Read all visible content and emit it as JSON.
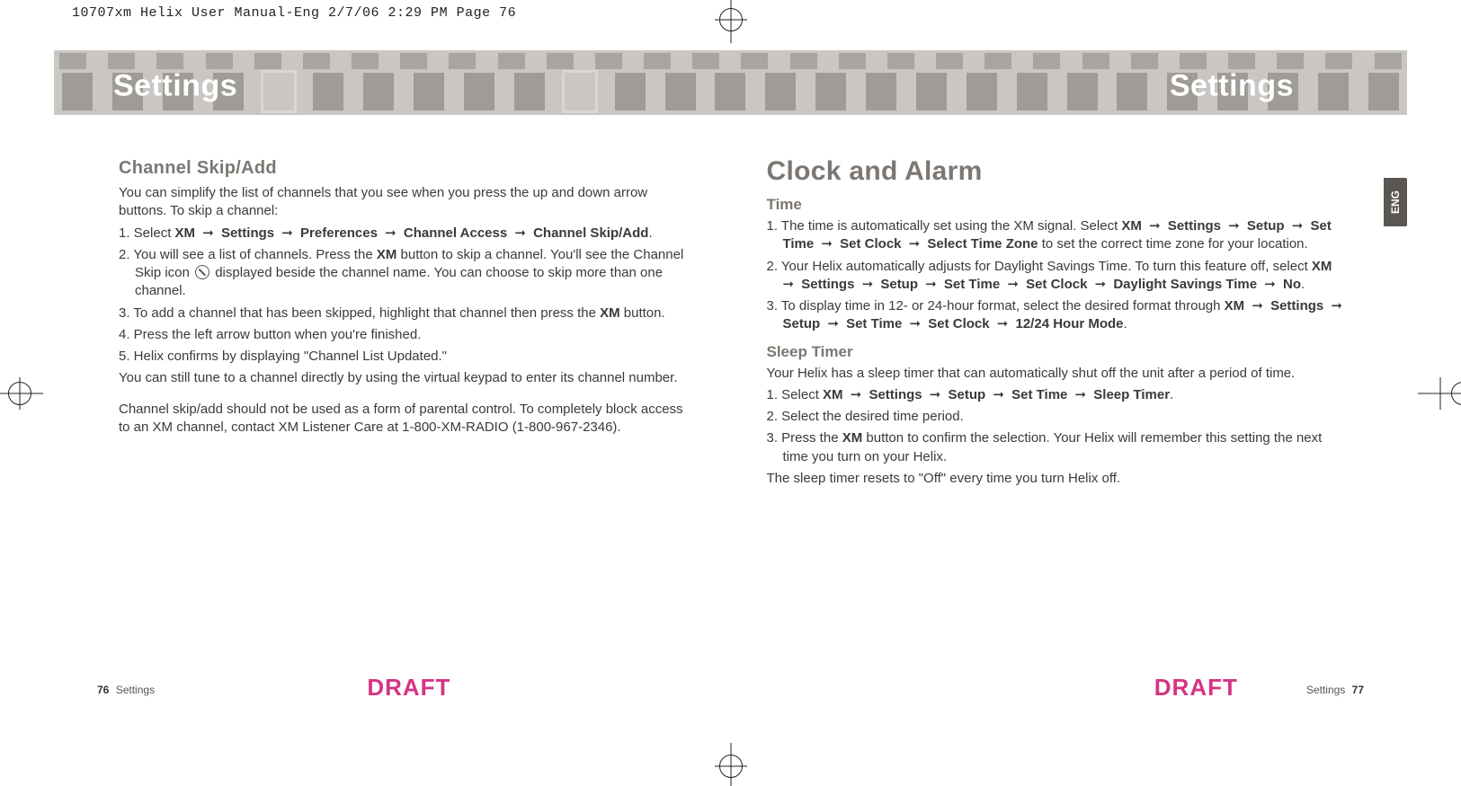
{
  "slug": "10707xm Helix User Manual-Eng  2/7/06  2:29 PM  Page 76",
  "banner": {
    "title_left": "Settings",
    "title_right": "Settings"
  },
  "lang_tab": "ENG",
  "arrow": "➞",
  "left": {
    "h2": "Channel Skip/Add",
    "intro": "You can simplify the list of channels that you see when you press the up and down arrow buttons. To skip a channel:",
    "steps": [
      {
        "pre": "1. Select ",
        "path": [
          "XM",
          "Settings",
          "Preferences",
          "Channel Access",
          "Channel Skip/Add"
        ],
        "post": "."
      },
      {
        "pre": "2. You will see a list of channels. Press the ",
        "bold1": "XM",
        "mid": " button to skip a channel. You'll see the Channel Skip icon ",
        "icon": true,
        "post": " displayed beside the channel name. You can choose to skip more than one channel."
      },
      {
        "pre": "3. To add a channel that has been skipped, highlight that channel then press the ",
        "bold1": "XM",
        "post": " button."
      },
      {
        "plain": "4. Press the left arrow button when you're finished."
      },
      {
        "plain": "5. Helix confirms by displaying \"Channel List Updated.\""
      }
    ],
    "p1": "You can still tune to a channel directly by using the virtual keypad to enter its channel number.",
    "p2": "Channel skip/add should not be used as a form of parental control. To completely block access to an XM channel, contact XM Listener Care at 1-800-XM-RADIO (1-800-967-2346)."
  },
  "right": {
    "h1": "Clock and Alarm",
    "time_h": "Time",
    "time_steps": [
      {
        "pre": "1. The time is automatically set using the XM signal. Select ",
        "path": [
          "XM",
          "Settings",
          "Setup",
          "Set Time",
          "Set Clock",
          "Select Time Zone"
        ],
        "post": " to set the correct time zone for your location."
      },
      {
        "pre": "2. Your Helix automatically adjusts for Daylight Savings Time. To turn this feature off, select ",
        "path": [
          "XM",
          "Settings",
          "Setup",
          "Set Time",
          "Set Clock",
          "Daylight Savings Time",
          "No"
        ],
        "post": "."
      },
      {
        "pre": "3. To display time in 12- or 24-hour format, select the desired format through ",
        "path": [
          "XM",
          "Settings",
          "Setup",
          "Set Time",
          "Set Clock",
          "12/24 Hour Mode"
        ],
        "post": "."
      }
    ],
    "sleep_h": "Sleep Timer",
    "sleep_intro": "Your Helix has a sleep timer that can automatically shut off the unit after a period of time.",
    "sleep_steps": [
      {
        "pre": "1. Select ",
        "path": [
          "XM",
          "Settings",
          "Setup",
          "Set Time",
          "Sleep Timer"
        ],
        "post": "."
      },
      {
        "plain": "2. Select the desired time period."
      },
      {
        "pre": "3. Press the ",
        "bold1": "XM",
        "post": " button to confirm the selection. Your Helix will remember this setting the next time you turn on your Helix."
      }
    ],
    "sleep_note": "The sleep timer resets to \"Off\" every time you turn Helix off."
  },
  "footer": {
    "left_num": "76",
    "left_label": "Settings",
    "right_num": "77",
    "right_label": "Settings",
    "draft": "DRAFT"
  }
}
